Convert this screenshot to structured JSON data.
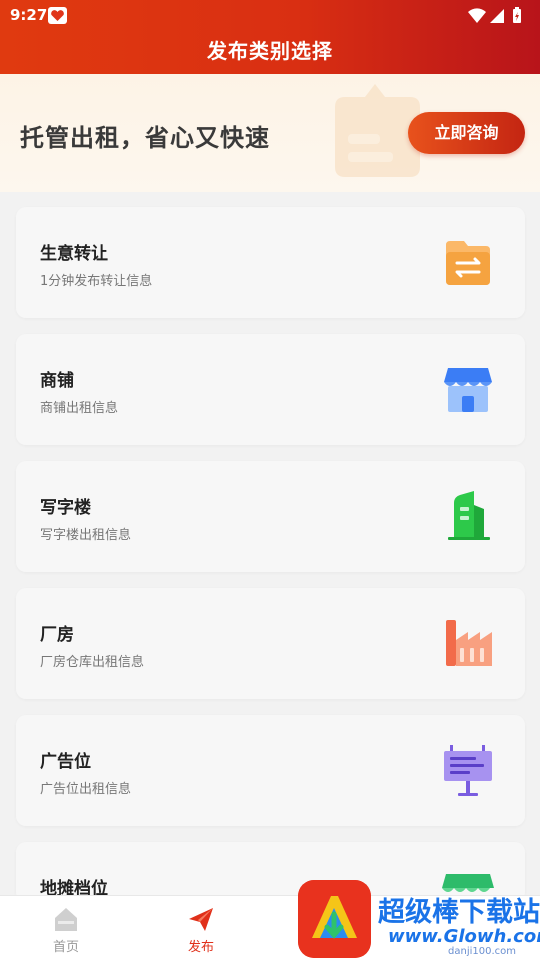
{
  "status_bar": {
    "time": "9:27"
  },
  "header": {
    "title": "发布类别选择"
  },
  "banner": {
    "text": "托管出租，省心又快速",
    "button_label": "立即咨询"
  },
  "categories": [
    {
      "title": "生意转让",
      "subtitle": "1分钟发布转让信息",
      "icon": "transfer-folder-icon",
      "color": "#f5a340"
    },
    {
      "title": "商铺",
      "subtitle": "商铺出租信息",
      "icon": "storefront-icon",
      "color": "#3b7df5"
    },
    {
      "title": "写字楼",
      "subtitle": "写字楼出租信息",
      "icon": "office-building-icon",
      "color": "#2dc94a"
    },
    {
      "title": "厂房",
      "subtitle": "厂房仓库出租信息",
      "icon": "factory-icon",
      "color": "#f26b4a"
    },
    {
      "title": "广告位",
      "subtitle": "广告位出租信息",
      "icon": "billboard-icon",
      "color": "#7a5de0"
    },
    {
      "title": "地摊档位",
      "subtitle": "",
      "icon": "market-stall-icon",
      "color": "#2dbb6a"
    }
  ],
  "tabbar": {
    "items": [
      {
        "label": "首页",
        "icon": "home-icon",
        "active": false
      },
      {
        "label": "发布",
        "icon": "paper-plane-icon",
        "active": true
      }
    ]
  },
  "watermark": {
    "title": "超级棒下载站",
    "subtitle": "www.Glowh.com",
    "small": "danji100.com"
  },
  "colors": {
    "accent": "#e03a10",
    "active_tab": "#e0301a",
    "inactive_tab": "#999999"
  }
}
